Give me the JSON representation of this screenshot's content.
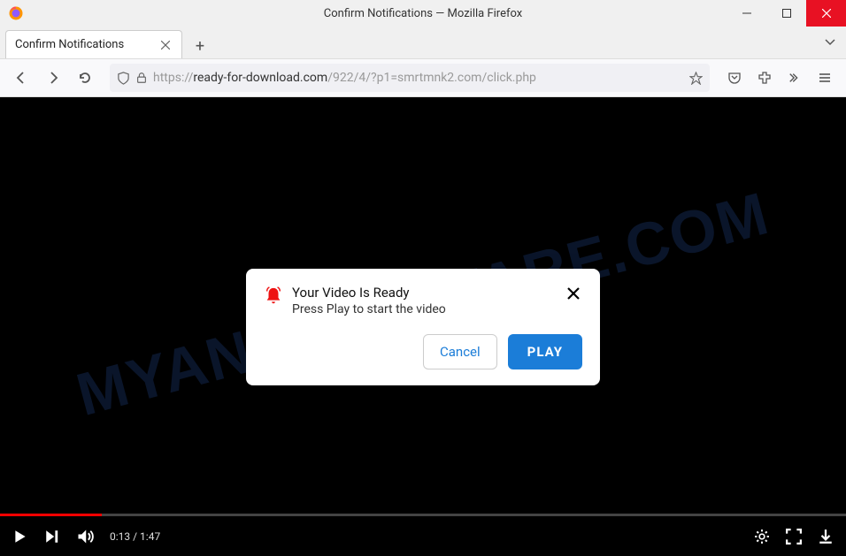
{
  "window": {
    "title": "Confirm Notifications — Mozilla Firefox"
  },
  "tab": {
    "title": "Confirm Notifications"
  },
  "url": {
    "protocol": "https://",
    "domain": "ready-for-download.com",
    "path": "/922/4/?p1=smrtmnk2.com/click.php"
  },
  "watermark": "MYANTISPYWARE.COM",
  "dialog": {
    "title": "Your Video Is Ready",
    "subtitle": "Press Play to start the video",
    "cancel": "Cancel",
    "play": "PLAY"
  },
  "video": {
    "current_time": "0:13",
    "duration": "1:47"
  }
}
